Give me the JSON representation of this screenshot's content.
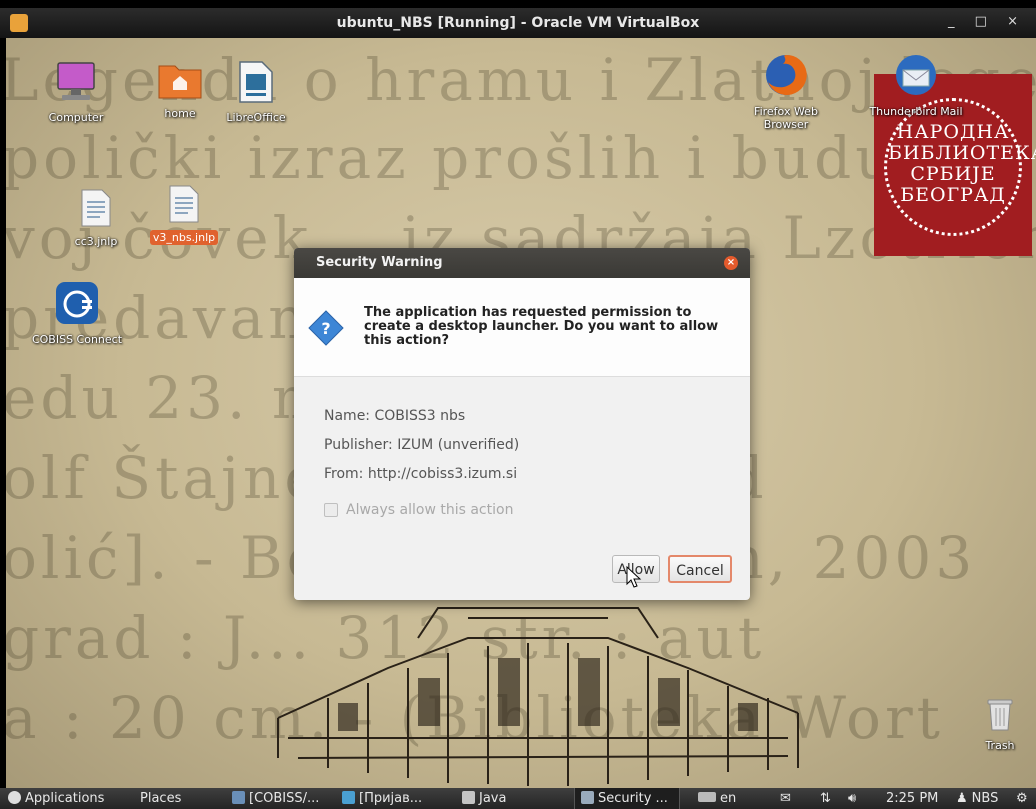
{
  "window": {
    "title": "ubuntu_NBS [Running] - Oracle VM VirtualBox",
    "controls": "_ □ ×"
  },
  "desktop": {
    "background_lines": [
      "Legenda o hramu i Zlatnoj legendi",
      "polički izraz prošlih i budućih",
      "voj čovek... iz sadržaja Lzotrich",
      "predavanja... Berlinu",
      "edu 23. ma... januara",
      "olf Štajner... og preved",
      "olić]. - Beograd : Jovan, 2003",
      "grad : J... 312 str. : aut",
      "a : 20 cm. - (Biblioteka Wort"
    ],
    "icons": [
      {
        "name": "computer-icon",
        "label": "Computer"
      },
      {
        "name": "home-folder-icon",
        "label": "home"
      },
      {
        "name": "libreoffice-icon",
        "label": "LibreOffice"
      },
      {
        "name": "firefox-icon",
        "label": "Firefox Web Browser"
      },
      {
        "name": "thunderbird-icon",
        "label": "Thunderbird Mail"
      },
      {
        "name": "file-icon",
        "label": "cc3.jnlp"
      },
      {
        "name": "file-icon",
        "label": "v3_nbs.jnlp"
      },
      {
        "name": "cobiss-connect-icon",
        "label": "COBISS Connect"
      },
      {
        "name": "trash-icon",
        "label": "Trash"
      }
    ],
    "logo_text": [
      "НАРОДНА",
      "БИБЛИОТЕКА",
      "СРБИЈЕ",
      "БЕОГРАД"
    ]
  },
  "dialog": {
    "title": "Security Warning",
    "message": "The application has requested permission to create a desktop launcher. Do you want to allow this action?",
    "name": "Name:  COBISS3 nbs",
    "publisher": "Publisher: IZUM (unverified)",
    "from": "From:  http://cobiss3.izum.si",
    "checkbox_label": "Always allow this action",
    "checkbox_checked": false,
    "allow_label": "Allow",
    "cancel_label": "Cancel"
  },
  "taskbar": {
    "applications": "Applications",
    "places": "Places",
    "windows": [
      "[COBISS/...",
      "[Пријав...",
      "Java",
      "Security ..."
    ],
    "keyboard": "en",
    "clock": "2:25 PM",
    "user": "NBS"
  },
  "colors": {
    "accent": "#e0622e",
    "dialog_title": "#3c3b37",
    "logo_red": "#a11d20",
    "taskbar": "#2e2e2e"
  }
}
